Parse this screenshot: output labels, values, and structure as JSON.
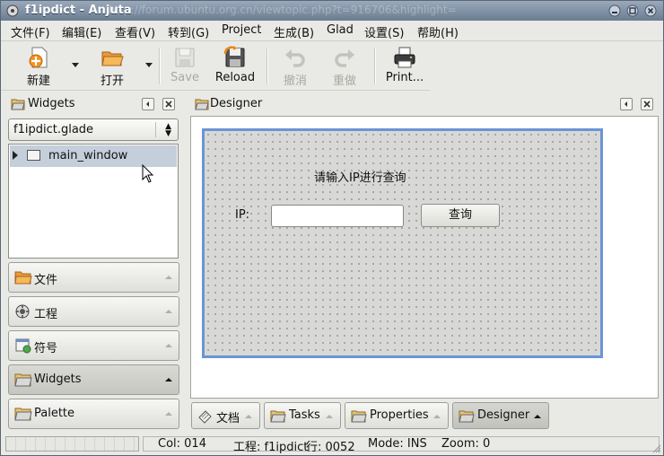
{
  "window": {
    "title": "f1ipdict - Anjuta",
    "ghost_url": "http://forum.ubuntu.org.cn/viewtopic.php?t=916706&highlight="
  },
  "menubar": {
    "items": [
      "文件(F)",
      "编辑(E)",
      "查看(V)",
      "转到(G)",
      "Project",
      "生成(B)",
      "Glad",
      "设置(S)",
      "帮助(H)"
    ]
  },
  "toolbar": {
    "new": "新建",
    "open": "打开",
    "save": "Save",
    "reload": "Reload",
    "undo": "撤消",
    "redo": "重做",
    "print": "Print..."
  },
  "widgets_pane": {
    "title": "Widgets",
    "combo_value": "f1ipdict.glade",
    "tree_item": "main_window"
  },
  "side_buttons": [
    "文件",
    "工程",
    "符号",
    "Widgets",
    "Palette"
  ],
  "designer": {
    "title": "Designer",
    "heading": "请输入IP进行查询",
    "ip_label": "IP:",
    "ip_value": "",
    "query_button": "查询"
  },
  "bottom_tabs": [
    "文档",
    "Tasks",
    "Properties",
    "Designer"
  ],
  "statusbar": {
    "col": "Col: 014",
    "project": "工程: f1ipdict",
    "line": "行: 0052",
    "mode": "Mode: INS",
    "zoom": "Zoom: 0"
  },
  "colors": {
    "titlebar": "#7f8fa4",
    "selection": "#c4cfdb",
    "window_border": "#6a95d6"
  },
  "icons": {
    "window": "anjuta-app-icon",
    "tool_new": "new-file-icon",
    "tool_open": "open-folder-icon",
    "tool_save": "save-icon",
    "tool_reload": "reload-icon",
    "tool_undo": "undo-icon",
    "tool_redo": "redo-icon",
    "tool_print": "printer-icon"
  }
}
